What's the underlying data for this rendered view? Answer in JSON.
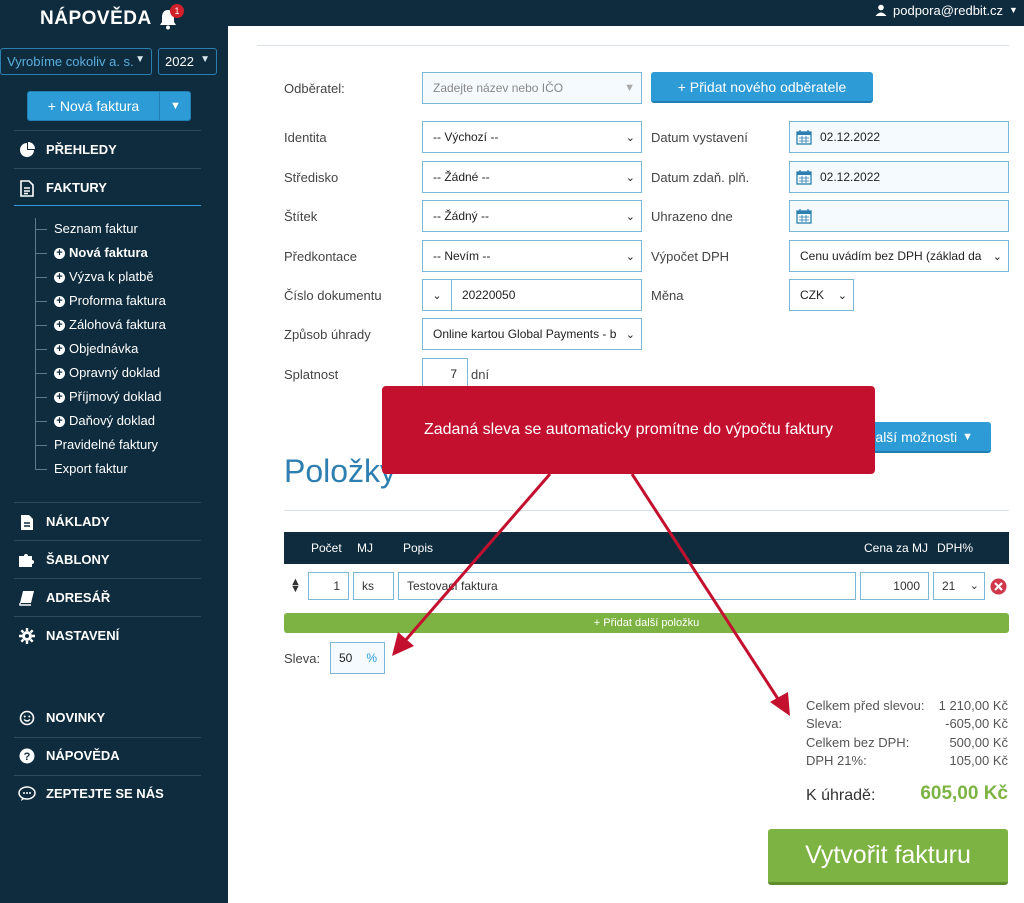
{
  "sidebar": {
    "title": "NÁPOVĚDA",
    "notification_count": "1",
    "company_select": "Vyrobíme cokoliv a. s.",
    "year_select": "2022",
    "new_invoice_button": "+ Nová faktura",
    "menu": {
      "overview": "PŘEHLEDY",
      "invoices": "FAKTURY",
      "costs": "NÁKLADY",
      "templates": "ŠABLONY",
      "address_book": "ADRESÁŘ",
      "settings": "NASTAVENÍ",
      "news": "NOVINKY",
      "help": "NÁPOVĚDA",
      "ask_us": "ZEPTEJTE SE NÁS"
    },
    "submenu": {
      "list": "Seznam faktur",
      "new": "Nová faktura",
      "payment_request": "Výzva k platbě",
      "proforma": "Proforma faktura",
      "advance": "Zálohová faktura",
      "order": "Objednávka",
      "correction": "Opravný doklad",
      "receipt": "Příjmový doklad",
      "tax": "Daňový doklad",
      "recurring": "Pravidelné faktury",
      "export": "Export faktur"
    }
  },
  "user": {
    "email": "podpora@redbit.cz"
  },
  "form": {
    "customer_label": "Odběratel:",
    "customer_placeholder": "Zadejte název nebo IČO",
    "add_customer_button": "+ Přidat nového odběratele",
    "identity_label": "Identita",
    "identity_value": "-- Výchozí --",
    "center_label": "Středisko",
    "center_value": "-- Žádné --",
    "tag_label": "Štítek",
    "tag_value": "-- Žádný --",
    "precontact_label": "Předkontace",
    "precontact_value": "-- Nevím --",
    "docnum_label": "Číslo dokumentu",
    "docnum_value": "20220050",
    "payment_label": "Způsob úhrady",
    "payment_value": "Online kartou Global Payments - b",
    "due_label": "Splatnost",
    "due_value": "7",
    "due_unit": "dní",
    "issue_date_label": "Datum vystavení",
    "issue_date_value": "02.12.2022",
    "tax_date_label": "Datum zdaň. plň.",
    "tax_date_value": "02.12.2022",
    "paid_label": "Uhrazeno dne",
    "paid_value": "",
    "vat_calc_label": "Výpočet DPH",
    "vat_calc_value": "Cenu uvádím bez DPH (základ da",
    "currency_label": "Měna",
    "currency_value": "CZK",
    "more_options": "Další možnosti"
  },
  "items": {
    "title": "Položky",
    "headers": {
      "count": "Počet",
      "unit": "MJ",
      "desc": "Popis",
      "price": "Cena za MJ",
      "vat": "DPH%"
    },
    "row": {
      "count": "1",
      "unit": "ks",
      "desc": "Testovací faktura",
      "price": "1000",
      "vat": "21"
    },
    "add_row": "+ Přidat další položku",
    "discount_label": "Sleva:",
    "discount_value": "50",
    "discount_unit": "%"
  },
  "summary": {
    "before_discount_label": "Celkem před slevou:",
    "before_discount_value": "1 210,00 Kč",
    "discount_label": "Sleva:",
    "discount_value": "-605,00 Kč",
    "without_vat_label": "Celkem bez DPH:",
    "without_vat_value": "500,00 Kč",
    "vat_label": "DPH 21%:",
    "vat_value": "105,00 Kč",
    "total_label": "K úhradě:",
    "total_value": "605,00 Kč"
  },
  "create_button": "Vytvořit fakturu",
  "tooltip": "Zadaná sleva se automaticky promítne do výpočtu faktury",
  "colors": {
    "sidebar_bg": "#0e2c3d",
    "accent_blue": "#2c9bd6",
    "accent_green": "#7cb342",
    "tooltip_red": "#c4102f"
  }
}
